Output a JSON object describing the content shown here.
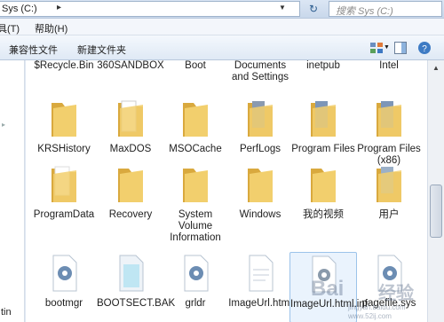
{
  "address": {
    "path": "Sys (C:)",
    "search_placeholder": "搜索 Sys (C:)"
  },
  "menu": {
    "tools": "工具(T)",
    "help": "帮助(H)"
  },
  "toolbar": {
    "compat_files": "兼容性文件",
    "new_folder": "新建文件夹"
  },
  "navpane": {
    "item1": "tin"
  },
  "items": [
    {
      "label": "$Recycle.Bin",
      "icon": "folder-icon"
    },
    {
      "label": "360SANDBOX",
      "icon": "folder-icon"
    },
    {
      "label": "Boot",
      "icon": "folder-icon"
    },
    {
      "label": "Documents and Settings",
      "icon": "shortcut-folder-icon"
    },
    {
      "label": "inetpub",
      "icon": "folder-icon"
    },
    {
      "label": "Intel",
      "icon": "folder-icon"
    },
    {
      "label": "KRSHistory",
      "icon": "folder-icon"
    },
    {
      "label": "MaxDOS",
      "icon": "folder-icon"
    },
    {
      "label": "MSOCache",
      "icon": "folder-icon"
    },
    {
      "label": "PerfLogs",
      "icon": "folder-icon"
    },
    {
      "label": "Program Files",
      "icon": "folder-icon"
    },
    {
      "label": "Program Files (x86)",
      "icon": "folder-icon"
    },
    {
      "label": "ProgramData",
      "icon": "folder-icon"
    },
    {
      "label": "Recovery",
      "icon": "folder-icon"
    },
    {
      "label": "System Volume Information",
      "icon": "folder-icon"
    },
    {
      "label": "Windows",
      "icon": "folder-icon"
    },
    {
      "label": "我的视频",
      "icon": "folder-icon"
    },
    {
      "label": "用户",
      "icon": "folder-icon"
    },
    {
      "label": "bootmgr",
      "icon": "system-file-icon"
    },
    {
      "label": "BOOTSECT.BAK",
      "icon": "file-icon"
    },
    {
      "label": "grldr",
      "icon": "system-file-icon"
    },
    {
      "label": "ImageUrl.html",
      "icon": "document-icon"
    },
    {
      "label": "ImageUrl.html.inf",
      "icon": "settings-file-icon"
    },
    {
      "label": "pagefile.sys",
      "icon": "system-file-icon"
    }
  ],
  "watermark": {
    "text1": "Bai",
    "text2": "经验",
    "text3": "jingyan.baidu.com",
    "text4": "www.52ij.com"
  },
  "colors": {
    "folder": "#f2cf6d",
    "folder_dark": "#d9a93e",
    "selection": "#9cc3ea"
  }
}
